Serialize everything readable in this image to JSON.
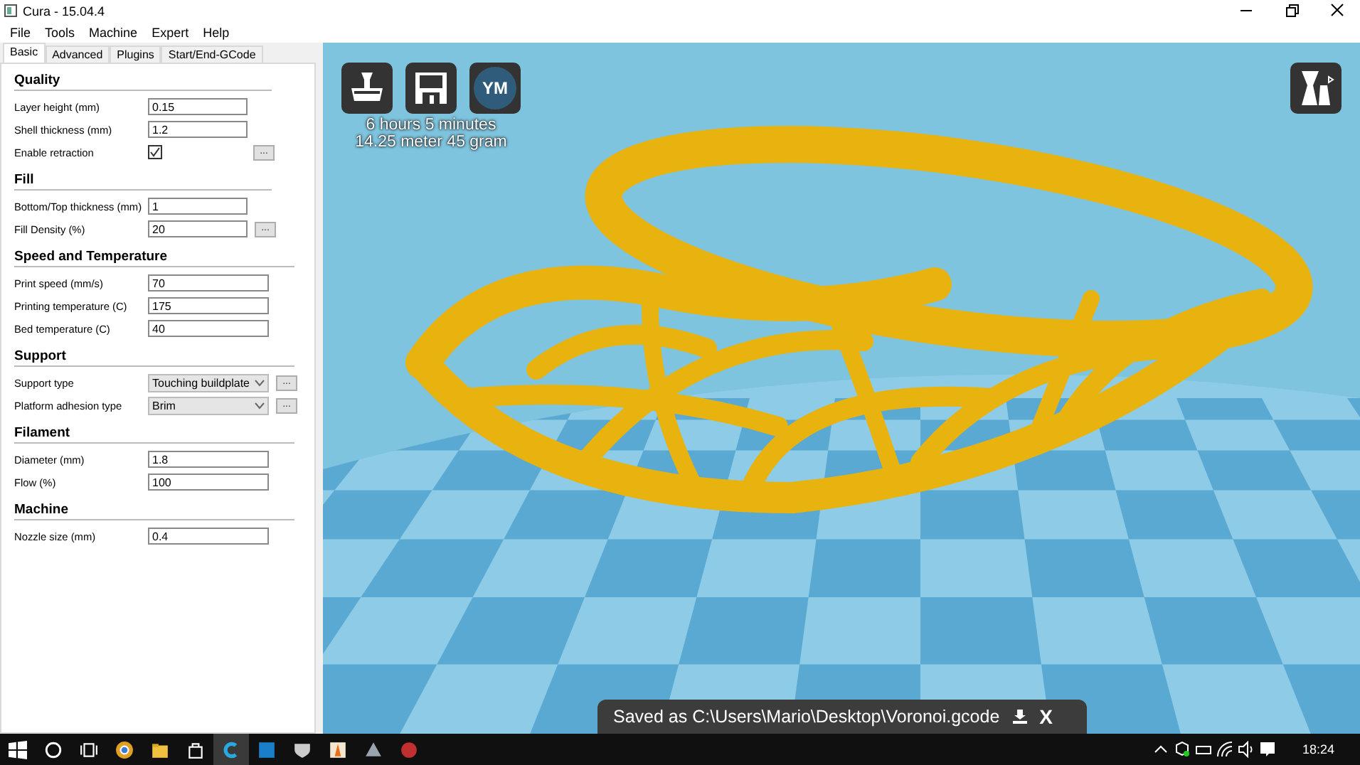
{
  "window": {
    "title": "Cura - 15.04.4"
  },
  "menu": [
    "File",
    "Tools",
    "Machine",
    "Expert",
    "Help"
  ],
  "tabs": [
    {
      "label": "Basic",
      "selected": true
    },
    {
      "label": "Advanced",
      "selected": false
    },
    {
      "label": "Plugins",
      "selected": false
    },
    {
      "label": "Start/End-GCode",
      "selected": false
    }
  ],
  "sections": [
    {
      "title": "Quality",
      "fields": [
        {
          "kind": "text",
          "label": "Layer height (mm)",
          "value": "0.15"
        },
        {
          "kind": "text",
          "label": "Shell thickness (mm)",
          "value": "1.2"
        },
        {
          "kind": "checkbox",
          "label": "Enable retraction",
          "checked": true,
          "more": "..."
        }
      ]
    },
    {
      "title": "Fill",
      "fields": [
        {
          "kind": "text",
          "label": "Bottom/Top thickness (mm)",
          "value": "1"
        },
        {
          "kind": "text",
          "label": "Fill Density (%)",
          "value": "20",
          "more": "..."
        }
      ]
    },
    {
      "title": "Speed and Temperature",
      "fields": [
        {
          "kind": "text",
          "label": "Print speed (mm/s)",
          "value": "70"
        },
        {
          "kind": "text",
          "label": "Printing temperature (C)",
          "value": "175"
        },
        {
          "kind": "text",
          "label": "Bed temperature (C)",
          "value": "40"
        }
      ]
    },
    {
      "title": "Support",
      "fields": [
        {
          "kind": "select",
          "label": "Support type",
          "value": "Touching buildplate",
          "more": "..."
        },
        {
          "kind": "select",
          "label": "Platform adhesion type",
          "value": "Brim",
          "more": "..."
        }
      ]
    },
    {
      "title": "Filament",
      "fields": [
        {
          "kind": "text",
          "label": "Diameter (mm)",
          "value": "1.8"
        },
        {
          "kind": "text",
          "label": "Flow (%)",
          "value": "100"
        }
      ]
    },
    {
      "title": "Machine",
      "fields": [
        {
          "kind": "text",
          "label": "Nozzle size (mm)",
          "value": "0.4"
        }
      ]
    }
  ],
  "viewport": {
    "buttons": [
      {
        "kind": "load"
      },
      {
        "kind": "save"
      },
      {
        "kind": "youmagine",
        "label": "YM"
      }
    ],
    "print_time": "6 hours 5 minutes",
    "print_usage": "14.25 meter 45 gram",
    "toast": {
      "message": "Saved as C:\\Users\\Mario\\Desktop\\Voronoi.gcode",
      "close": "X"
    }
  },
  "taskbar": {
    "apps": [
      {
        "kind": "browser",
        "selected": false
      },
      {
        "kind": "folder",
        "selected": false
      },
      {
        "kind": "store",
        "selected": false
      },
      {
        "kind": "cura",
        "selected": true
      },
      {
        "kind": "blue",
        "selected": false
      },
      {
        "kind": "shield",
        "selected": false
      },
      {
        "kind": "orange",
        "selected": false
      },
      {
        "kind": "triangle",
        "selected": false
      },
      {
        "kind": "sphere",
        "selected": false
      }
    ],
    "clock": "18:24"
  }
}
